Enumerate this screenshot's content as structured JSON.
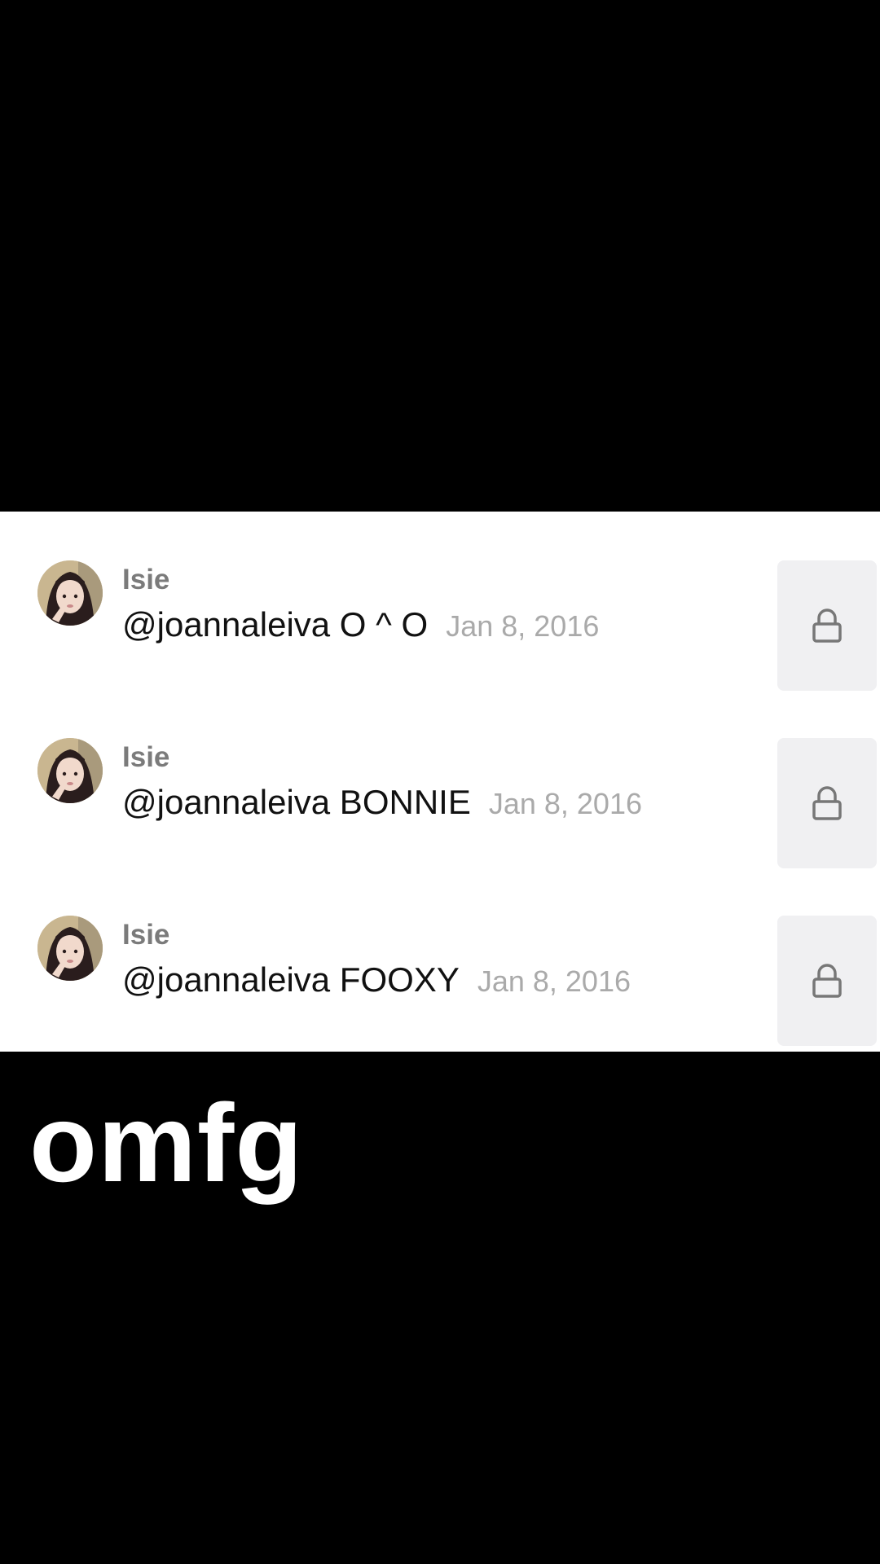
{
  "comments": [
    {
      "username": "Isie",
      "text": "@joannaleiva O ^ O",
      "date": "Jan 8, 2016",
      "avatar_icon": "user-avatar",
      "lock_icon": "lock-icon"
    },
    {
      "username": "Isie",
      "text": "@joannaleiva BONNIE",
      "date": "Jan 8, 2016",
      "avatar_icon": "user-avatar",
      "lock_icon": "lock-icon"
    },
    {
      "username": "Isie",
      "text": "@joannaleiva FOOXY",
      "date": "Jan 8, 2016",
      "avatar_icon": "user-avatar",
      "lock_icon": "lock-icon"
    }
  ],
  "caption": "omfg",
  "colors": {
    "background": "#000000",
    "panel": "#ffffff",
    "username": "#7b7b7b",
    "comment_text": "#111111",
    "date": "#aaaaaa",
    "lock_box": "#f0f0f2",
    "caption": "#ffffff"
  }
}
